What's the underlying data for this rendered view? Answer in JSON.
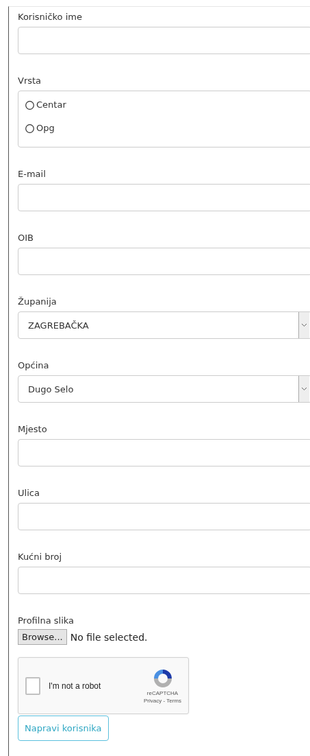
{
  "fields": [
    {
      "kind": "text",
      "label": "Korisničko ime"
    },
    {
      "kind": "radio",
      "label": "Vrsta",
      "options": [
        {
          "label": "Centar",
          "selected": false
        },
        {
          "label": "Opg",
          "selected": false
        }
      ]
    },
    {
      "kind": "text",
      "label": "E-mail"
    },
    {
      "kind": "text",
      "label": "OIB"
    },
    {
      "kind": "select",
      "label": "Županija",
      "value": "ZAGREBAČKA"
    },
    {
      "kind": "select",
      "label": "Općina",
      "value": "Dugo Selo"
    },
    {
      "kind": "text",
      "label": "Mjesto"
    },
    {
      "kind": "text",
      "label": "Ulica"
    },
    {
      "kind": "text",
      "label": "Kućni broj"
    },
    {
      "kind": "file",
      "label": "Profilna slika",
      "button": "Browse...",
      "status": "No file selected."
    }
  ],
  "captcha": {
    "label": "I'm not a robot",
    "checked": false,
    "brand": "reCAPTCHA",
    "links": "Privacy - Terms"
  },
  "submit": "Napravi korisnika"
}
